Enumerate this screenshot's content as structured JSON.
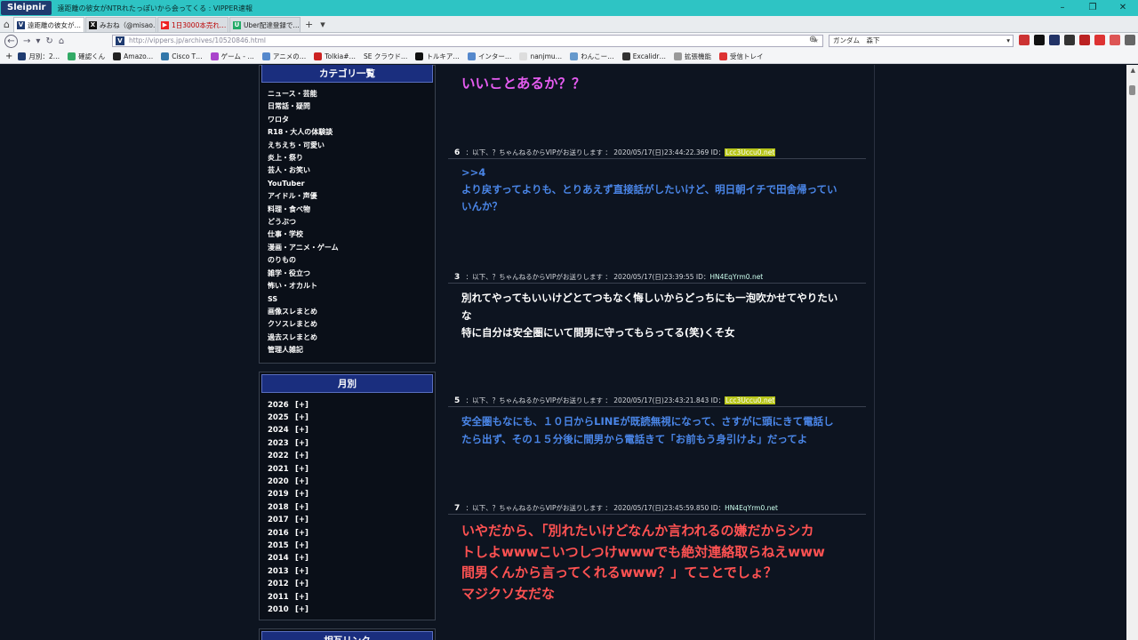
{
  "window": {
    "app_name": "Sleipnir",
    "title": "遠距離の彼女がNTRれたっぽいから会ってくる : VIPPER速報"
  },
  "tabs": [
    {
      "label": "遠距離の彼女が…",
      "active": true,
      "icon": "V"
    },
    {
      "label": "みおね（@misao…",
      "active": false,
      "icon": "X"
    },
    {
      "label": "1日3000本売れ…",
      "active": false,
      "icon": "yt"
    },
    {
      "label": "Uber配達登録で…",
      "active": false,
      "icon": "app"
    }
  ],
  "nav": {
    "url": "http://vippers.jp/archives/10520846.html",
    "search": "ガンダム　森下"
  },
  "bookmarks": [
    "月別：2…",
    "確認くん",
    "Amazo…",
    "Cisco T…",
    "ゲーム - …",
    "アニメの…",
    "Tolkia#…",
    "SE クラウド…",
    "トルキア…",
    "インター…",
    "nanjmu…",
    "わんこー…",
    "Excalidr…",
    "拡張機能",
    "受信トレイ"
  ],
  "sidebar": {
    "category_title": "カテゴリ一覧",
    "categories": [
      "ニュース・芸能",
      "日常話・疑問",
      "ワロタ",
      "R18・大人の体験談",
      "えちえち・可愛い",
      "炎上・祭り",
      "芸人・お笑い",
      "YouTuber",
      "アイドル・声優",
      "料理・食べ物",
      "どうぶつ",
      "仕事・学校",
      "漫画・アニメ・ゲーム",
      "のりもの",
      "雑学・役立つ",
      "怖い・オカルト",
      "SS",
      "画像スレまとめ",
      "クソスレまとめ",
      "過去スレまとめ",
      "管理人雑記"
    ],
    "monthly_title": "月別",
    "years": [
      "2026",
      "2025",
      "2024",
      "2023",
      "2022",
      "2021",
      "2020",
      "2019",
      "2018",
      "2017",
      "2016",
      "2015",
      "2014",
      "2013",
      "2012",
      "2011",
      "2010"
    ],
    "expand_label": "[+]",
    "links_title": "相互リンク"
  },
  "posts": [
    {
      "num": "",
      "header": "",
      "id": "",
      "lines": [
        "いいことあるか？？"
      ],
      "color": "pink"
    },
    {
      "num": "6",
      "header": " ：以下、？ちゃんねるからVIPがお送りします ： 2020/05/17(日)23:44:22.369 ID：",
      "id": "Lcc3Uccu0.net",
      "highlight": true,
      "lines": [
        ">>4",
        "より戻すってよりも、とりあえず直接話がしたいけど、明日朝イチで田舎帰ってい",
        "いんか？"
      ],
      "color": "blue"
    },
    {
      "num": "3",
      "header": " ：以下、？ちゃんねるからVIPがお送りします ： 2020/05/17(日)23:39:55 ID：",
      "id": "HN4EqYrm0.net",
      "highlight": false,
      "lines": [
        "別れてやってもいいけどとてつもなく悔しいからどっちにも一泡吹かせてやりたい",
        "な",
        "特に自分は安全圏にいて間男に守ってもらってる(笑)くそ女"
      ],
      "color": "white"
    },
    {
      "num": "5",
      "header": " ：以下、？ちゃんねるからVIPがお送りします ： 2020/05/17(日)23:43:21.843 ID：",
      "id": "Lcc3Uccu0.net",
      "highlight": true,
      "lines": [
        "安全圏もなにも、１０日からLINEが既読無視になって、さすがに頭にきて電話し",
        "たら出ず、その１５分後に間男から電話きて「お前もう身引けよ」だってよ"
      ],
      "color": "blue"
    },
    {
      "num": "7",
      "header": " ：以下、？ちゃんねるからVIPがお送りします ： 2020/05/17(日)23:45:59.850 ID：",
      "id": "HN4EqYrm0.net",
      "highlight": false,
      "lines": [
        "いやだから、「別れたいけどなんか言われるの嫌だからシカ",
        "トしよwwwこいつしつけwwwでも絶対連絡取らねえwww",
        "間男くんから言ってくれるwww？」てことでしょ？",
        "マジクソ女だな"
      ],
      "color": "red"
    }
  ]
}
